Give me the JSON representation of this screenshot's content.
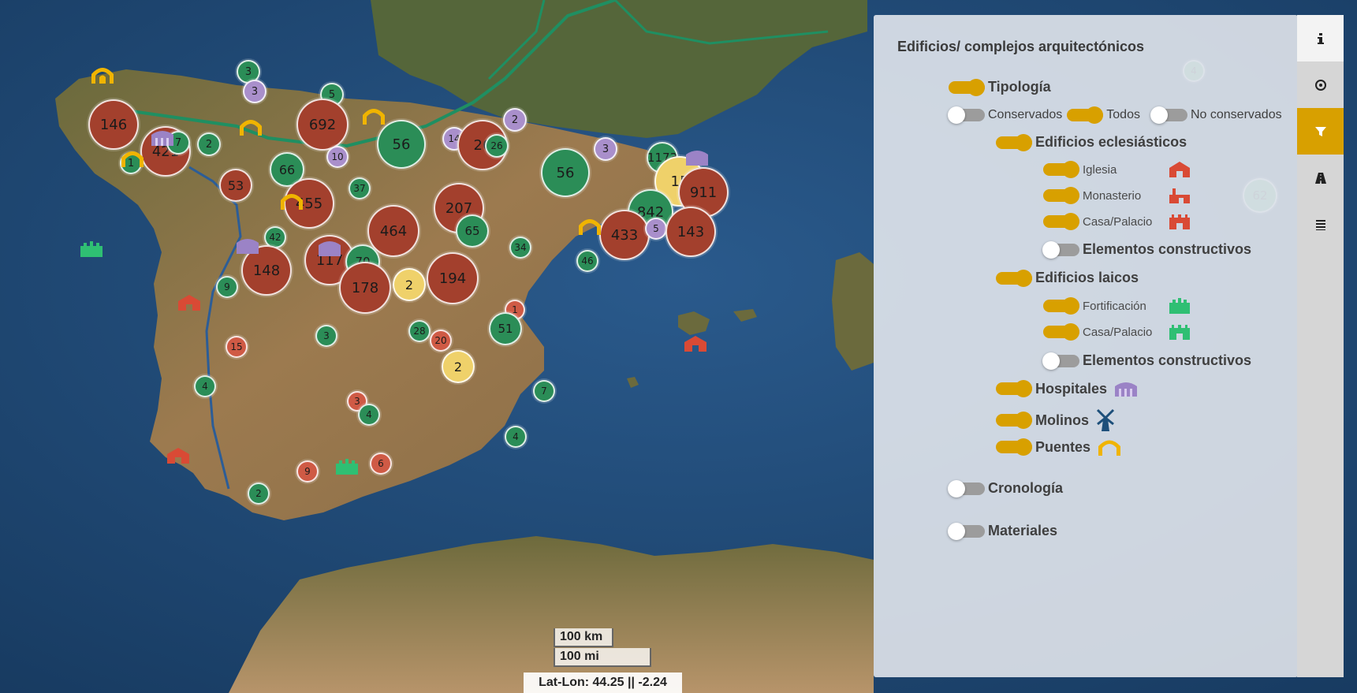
{
  "scale": {
    "km": "100 km",
    "mi": "100 mi"
  },
  "coords": {
    "text": "Lat-Lon: 44.25 || -2.24"
  },
  "clusters": [
    {
      "label": "146",
      "color": "red"
    },
    {
      "label": "421",
      "color": "red"
    },
    {
      "label": "7",
      "color": "green"
    },
    {
      "label": "2",
      "color": "green"
    },
    {
      "label": "1",
      "color": "green"
    },
    {
      "label": "3",
      "color": "green"
    },
    {
      "label": "3",
      "color": "purple"
    },
    {
      "label": "5",
      "color": "green"
    },
    {
      "label": "692",
      "color": "red"
    },
    {
      "label": "56",
      "color": "green"
    },
    {
      "label": "14",
      "color": "purple"
    },
    {
      "label": "26",
      "color": "red"
    },
    {
      "label": "26",
      "color": "green"
    },
    {
      "label": "2",
      "color": "purple"
    },
    {
      "label": "3",
      "color": "purple"
    },
    {
      "label": "66",
      "color": "green"
    },
    {
      "label": "10",
      "color": "purple"
    },
    {
      "label": "53",
      "color": "red"
    },
    {
      "label": "37",
      "color": "green"
    },
    {
      "label": "455",
      "color": "red"
    },
    {
      "label": "207",
      "color": "red"
    },
    {
      "label": "65",
      "color": "green"
    },
    {
      "label": "464",
      "color": "red"
    },
    {
      "label": "42",
      "color": "green"
    },
    {
      "label": "148",
      "color": "red"
    },
    {
      "label": "117",
      "color": "red"
    },
    {
      "label": "70",
      "color": "green"
    },
    {
      "label": "178",
      "color": "red"
    },
    {
      "label": "2",
      "color": "yellow"
    },
    {
      "label": "194",
      "color": "red"
    },
    {
      "label": "9",
      "color": "green"
    },
    {
      "label": "34",
      "color": "green"
    },
    {
      "label": "56",
      "color": "green"
    },
    {
      "label": "1173",
      "color": "red"
    },
    {
      "label": "15",
      "color": "yellow"
    },
    {
      "label": "911",
      "color": "red"
    },
    {
      "label": "842",
      "color": "green"
    },
    {
      "label": "433",
      "color": "red"
    },
    {
      "label": "5",
      "color": "purple"
    },
    {
      "label": "143",
      "color": "red"
    },
    {
      "label": "46",
      "color": "green"
    },
    {
      "label": "1",
      "color": "lightred"
    },
    {
      "label": "51",
      "color": "green"
    },
    {
      "label": "28",
      "color": "green"
    },
    {
      "label": "20",
      "color": "lightred"
    },
    {
      "label": "3",
      "color": "green"
    },
    {
      "label": "15",
      "color": "lightred"
    },
    {
      "label": "2",
      "color": "yellow"
    },
    {
      "label": "4",
      "color": "green"
    },
    {
      "label": "3",
      "color": "lightred"
    },
    {
      "label": "4",
      "color": "green"
    },
    {
      "label": "7",
      "color": "green"
    },
    {
      "label": "4",
      "color": "green"
    },
    {
      "label": "9",
      "color": "lightred"
    },
    {
      "label": "6",
      "color": "lightred"
    },
    {
      "label": "2",
      "color": "green"
    },
    {
      "label": "4",
      "color": "lightgreen"
    },
    {
      "label": "62",
      "color": "lightgreen"
    }
  ],
  "panel": {
    "title": "Edificios/ complejos arquitectónicos",
    "tipologia": "Tipología",
    "conservados": "Conservados",
    "todos": "Todos",
    "no_conservados": "No conservados",
    "eclesiasticos": "Edificios eclesiásticos",
    "iglesia": "Iglesia",
    "monasterio": "Monasterio",
    "casa_palacio_1": "Casa/Palacio",
    "elementos_1": "Elementos constructivos",
    "laicos": "Edificios laicos",
    "fortificacion": "Fortificación",
    "casa_palacio_2": "Casa/Palacio",
    "elementos_2": "Elementos constructivos",
    "hospitales": "Hospitales",
    "molinos": "Molinos",
    "puentes": "Puentes",
    "cronologia": "Cronología",
    "materiales": "Materiales"
  },
  "toggles": {
    "tipologia": true,
    "conservados": false,
    "todos": true,
    "no_conservados": false,
    "eclesiasticos": true,
    "iglesia": true,
    "monasterio": true,
    "casa_palacio_1": true,
    "elementos_1": false,
    "laicos": true,
    "fortificacion": true,
    "casa_palacio_2": true,
    "elementos_2": false,
    "hospitales": true,
    "molinos": true,
    "puentes": true,
    "cronologia": false,
    "materiales": false
  },
  "tabs": [
    "info-icon",
    "compass-icon",
    "filter-icon",
    "road-icon",
    "layers-icon"
  ],
  "colors": {
    "accent": "#d8a000",
    "church_red": "#d94a35",
    "civil_green": "#2fbf73",
    "hospital_purple": "#9b83c6",
    "mill_blue": "#1d4f7a",
    "bridge_yellow": "#f0b400"
  }
}
